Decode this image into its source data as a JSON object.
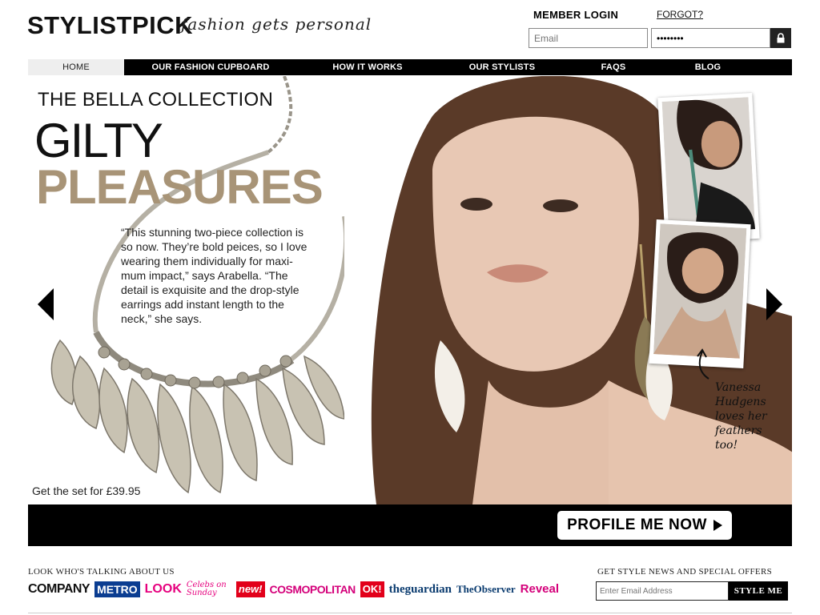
{
  "header": {
    "logo": "STYLISTPICK",
    "tagline": "fashion gets personal",
    "login_title": "MEMBER LOGIN",
    "forgot": "FORGOT?",
    "email_placeholder": "Email",
    "password_value": "••••••••",
    "lock_icon": "lock-icon"
  },
  "nav": {
    "items": [
      {
        "label": "HOME",
        "active": true
      },
      {
        "label": "OUR FASHION CUPBOARD",
        "active": false
      },
      {
        "label": "HOW IT WORKS",
        "active": false
      },
      {
        "label": "OUR STYLISTS",
        "active": false
      },
      {
        "label": "FAQS",
        "active": false
      },
      {
        "label": "BLOG",
        "active": false
      }
    ]
  },
  "hero": {
    "collection_title": "THE BELLA COLLECTION",
    "headline_1": "GILTY",
    "headline_2": "PLEASURES",
    "quote": "“This stunning two-piece collection is so now. They’re bold peices, so I love wearing them individually for maxi-mum impact,” says Arabella. “The detail is exquisite and the drop-style earrings add instant length to the neck,” she says.",
    "price": "Get the set for £39.95",
    "side_note": "Vanessa Hudgens loves her feathers too!",
    "accent_color": "#a89477"
  },
  "cta": {
    "label": "PROFILE ME NOW"
  },
  "footer": {
    "talking_title": "LOOK WHO'S TALKING ABOUT US",
    "press": [
      {
        "name": "COMPANY",
        "color": "#111111"
      },
      {
        "name": "METRO",
        "color": "#0b3d91"
      },
      {
        "name": "LOOK",
        "color": "#e6007e"
      },
      {
        "name": "Celebs on Sunday",
        "color": "#e6007e"
      },
      {
        "name": "new!",
        "color": "#e2001a"
      },
      {
        "name": "COSMOPOLITAN",
        "color": "#d4007a"
      },
      {
        "name": "OK!",
        "color": "#e2001a"
      },
      {
        "name": "theguardian",
        "color": "#0a3b6f"
      },
      {
        "name": "TheObserver",
        "color": "#0a3b6f"
      },
      {
        "name": "Reveal",
        "color": "#d4007a"
      }
    ],
    "news_title": "GET STYLE NEWS AND SPECIAL OFFERS",
    "news_placeholder": "Enter Email Address",
    "news_button": "STYLE ME"
  }
}
